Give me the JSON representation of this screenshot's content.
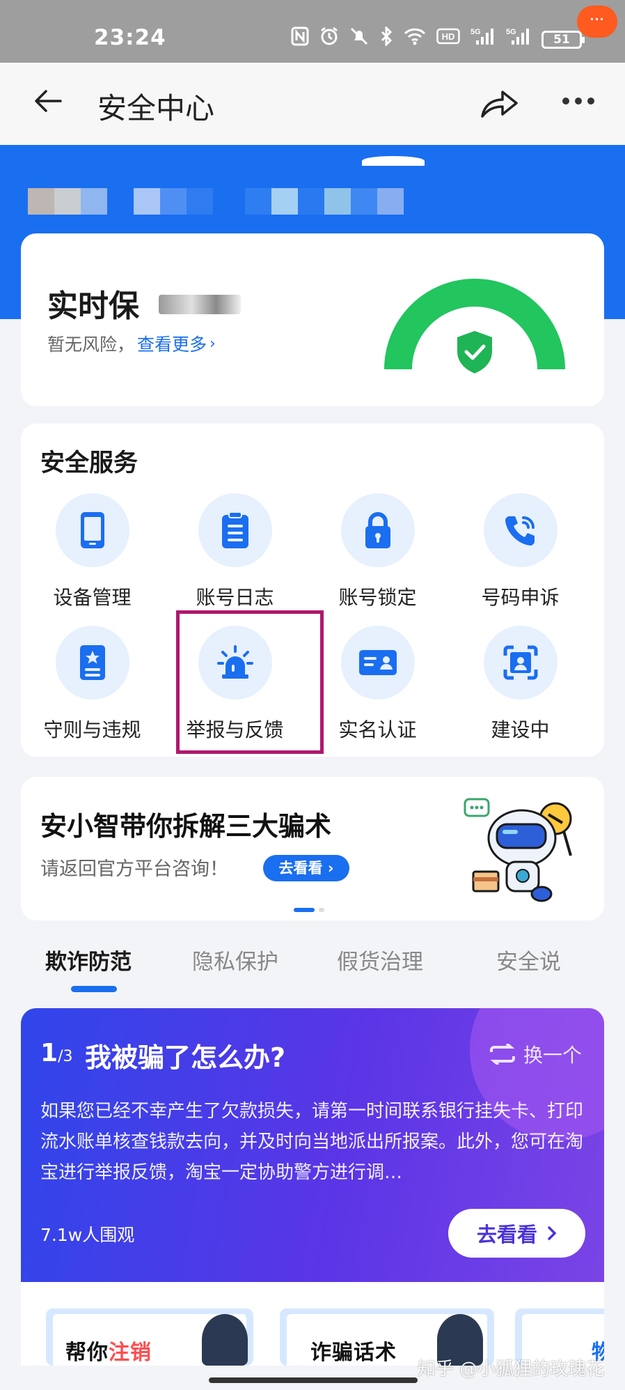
{
  "status_bar": {
    "time": "23:24",
    "icons": [
      "nfc-icon",
      "alarm-icon",
      "mute-icon",
      "bluetooth-icon",
      "wifi-icon",
      "hd-icon",
      "signal-5g-icon",
      "signal-5g-icon"
    ],
    "hd_label": "HD",
    "net_label": "5G",
    "battery": "51"
  },
  "nav": {
    "title": "安全中心",
    "badge": "···"
  },
  "realtime": {
    "title": "实时保",
    "subtitle": "暂无风险，",
    "link": "查看更多"
  },
  "services": {
    "title": "安全服务",
    "items": [
      {
        "label": "设备管理",
        "icon": "phone-icon"
      },
      {
        "label": "账号日志",
        "icon": "log-icon"
      },
      {
        "label": "账号锁定",
        "icon": "lock-icon"
      },
      {
        "label": "号码申诉",
        "icon": "phone-call-icon"
      },
      {
        "label": "守则与违规",
        "icon": "rulebook-icon"
      },
      {
        "label": "举报与反馈",
        "icon": "alarm-light-icon"
      },
      {
        "label": "实名认证",
        "icon": "id-card-icon"
      },
      {
        "label": "建设中",
        "icon": "face-scan-icon"
      }
    ]
  },
  "promo": {
    "title": "安小智带你拆解三大骗术",
    "subtitle": "请返回官方平台咨询！",
    "button": "去看看 ›"
  },
  "tabs": [
    "欺诈防范",
    "隐私保护",
    "假货治理",
    "安全说"
  ],
  "fraud": {
    "index": "1",
    "total": "/3",
    "title": "我被骗了怎么办?",
    "swap": "换一个",
    "body": "如果您已经不幸产生了欠款损失，请第一时间联系银行挂失卡、打印流水账单核查钱款去向，并及时向当地派出所报案。此外，您可在淘宝进行举报反馈，淘宝一定协助警方进行调…",
    "views": "7.1w人围观",
    "button": "去看看"
  },
  "thumbs": {
    "first_prefix": "帮你",
    "first_highlight": "注销",
    "second": "诈骗话术",
    "third": "物流"
  },
  "watermark": "知乎 @小狐狸的玫瑰花",
  "colors": {
    "brand_blue": "#1a6ef0",
    "green": "#22c55e",
    "highlight": "#b0176d",
    "fraud_purple": "#5b35e6"
  }
}
